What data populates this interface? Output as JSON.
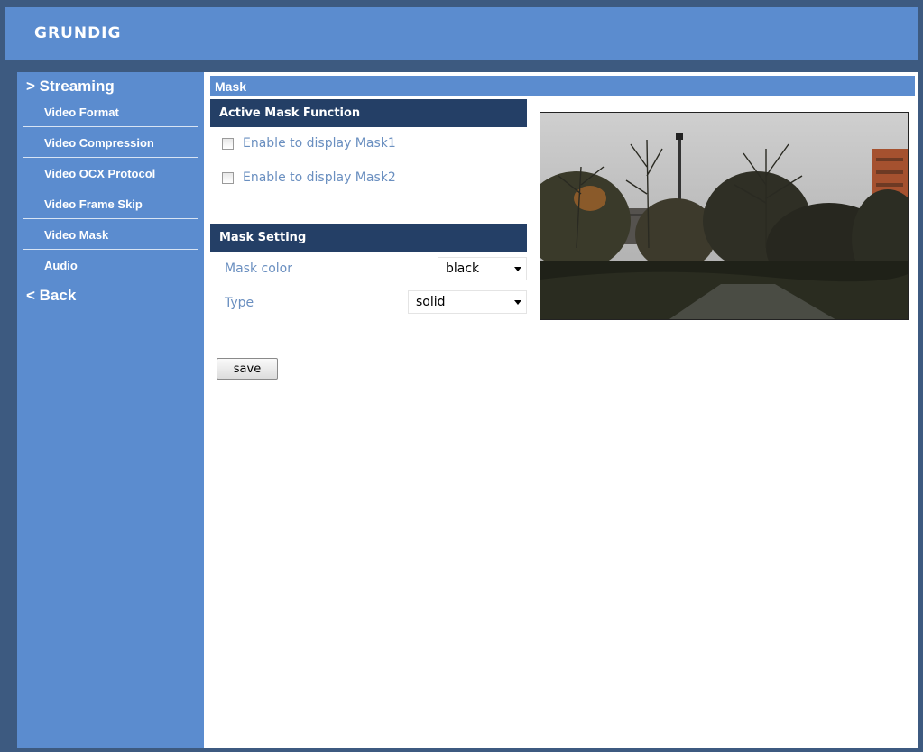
{
  "brand": {
    "logo_text": "GRUNDIG"
  },
  "sidebar": {
    "section_label": "> Streaming",
    "items": [
      {
        "label": "Video Format"
      },
      {
        "label": "Video Compression"
      },
      {
        "label": "Video OCX Protocol"
      },
      {
        "label": "Video Frame Skip"
      },
      {
        "label": "Video Mask"
      },
      {
        "label": "Audio"
      }
    ],
    "back_label": "< Back"
  },
  "main": {
    "title": "Mask",
    "active_mask": {
      "heading": "Active Mask Function",
      "mask1_label": "Enable to display Mask1",
      "mask1_checked": false,
      "mask2_label": "Enable to display Mask2",
      "mask2_checked": false
    },
    "mask_setting": {
      "heading": "Mask Setting",
      "color_label": "Mask color",
      "color_value": "black",
      "type_label": "Type",
      "type_value": "solid"
    },
    "save_label": "save"
  },
  "colors": {
    "frame": "#3d5a80",
    "header": "#5b8ccf",
    "section_header": "#243f66",
    "label_text": "#6a8fc0"
  }
}
